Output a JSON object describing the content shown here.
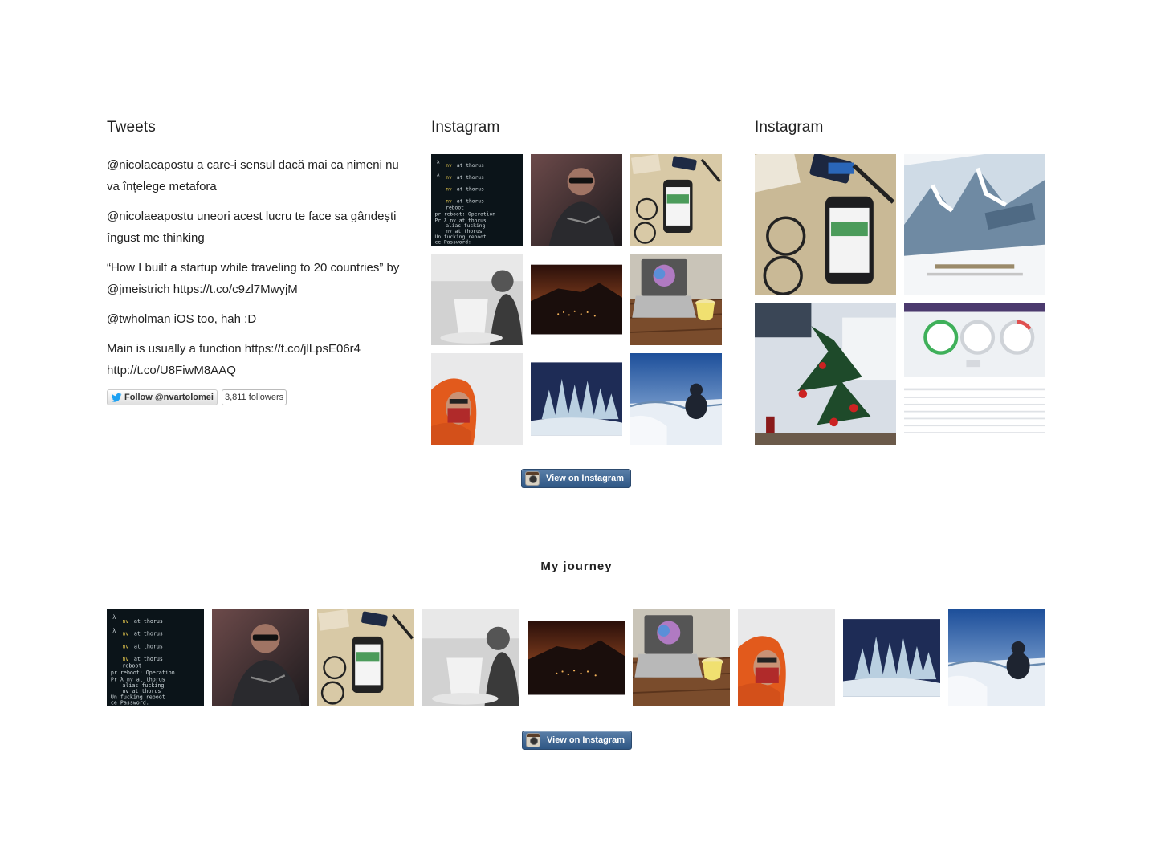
{
  "tweets": {
    "title": "Tweets",
    "items": [
      {
        "text": "@nicolaeapostu a care-i sensul dacă mai ca nimeni nu va înțelege metafora"
      },
      {
        "text": "@nicolaeapostu uneori acest lucru te face sa gândești îngust me thinking"
      },
      {
        "text": "“How I built a startup while traveling to 20 countries” by @jmeistrich https://t.co/c9zl7MwyjM"
      },
      {
        "text": "@twholman iOS too, hah :D"
      },
      {
        "text": "Main is usually a function https://t.co/jlLpsE06r4 http://t.co/U8FiwM8AAQ"
      }
    ],
    "follow_label": "Follow @nvartolomei",
    "followers_label": "3,811 followers"
  },
  "instagram_small": {
    "title": "Instagram",
    "button_label": "View on Instagram"
  },
  "instagram_large": {
    "title": "Instagram"
  },
  "journey": {
    "title": "My journey",
    "button_label": "View on Instagram"
  },
  "colors": {
    "twitter_blue": "#1da1f2",
    "ig_button": "#2f5785"
  }
}
